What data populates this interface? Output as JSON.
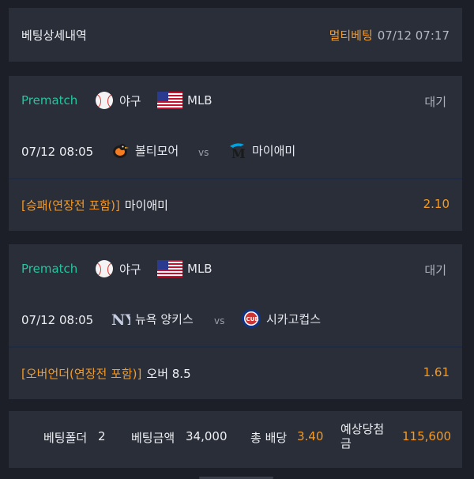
{
  "header": {
    "title": "베팅상세내역",
    "bet_type": "멀티베팅",
    "datetime": "07/12 07:17"
  },
  "bets": [
    {
      "prematch": "Prematch",
      "sport": "야구",
      "league": "MLB",
      "status": "대기",
      "match_time": "07/12 08:05",
      "home_team": "볼티모어",
      "vs": "vs",
      "away_team": "마이애미",
      "market": "[승패(연장전 포함)]",
      "pick": "마이애미",
      "odds": "2.10"
    },
    {
      "prematch": "Prematch",
      "sport": "야구",
      "league": "MLB",
      "status": "대기",
      "match_time": "07/12 08:05",
      "home_team": "뉴욕 양키스",
      "vs": "vs",
      "away_team": "시카고컵스",
      "market": "[오버언더(연장전 포함)]",
      "pick": "오버 8.5",
      "odds": "1.61"
    }
  ],
  "summary": {
    "folder_label": "베팅폴더",
    "folder_value": "2",
    "amount_label": "베팅금액",
    "amount_value": "34,000",
    "total_odds_label": "총 배당",
    "total_odds_value": "3.40",
    "expected_win_label": "예상당첨금",
    "expected_win_value": "115,600"
  },
  "colors": {
    "accent": "#f59a23",
    "prematch": "#22c6a0",
    "panel": "#2a2e38",
    "background": "#1c1f27"
  }
}
